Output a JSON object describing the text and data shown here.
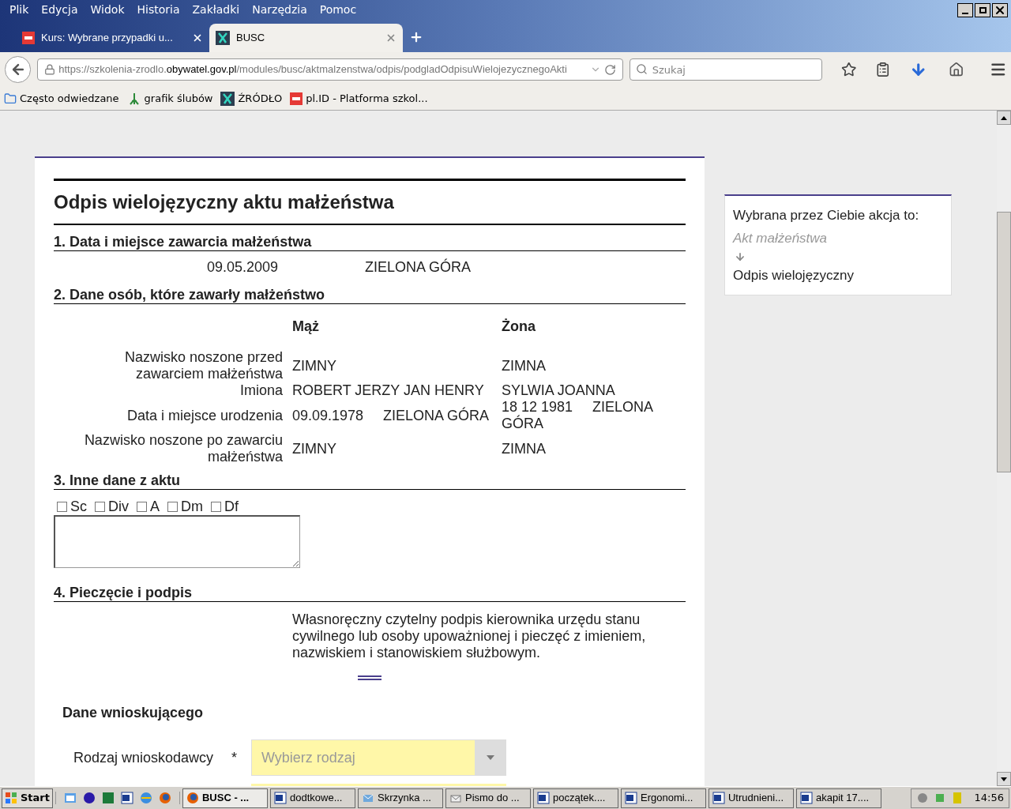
{
  "menu": [
    "Plik",
    "Edycja",
    "Widok",
    "Historia",
    "Zakładki",
    "Narzędzia",
    "Pomoc"
  ],
  "tabs": [
    {
      "label": "Kurs: Wybrane przypadki u...",
      "kind": "plid",
      "selected": false
    },
    {
      "label": "BUSC",
      "kind": "busc",
      "selected": true
    }
  ],
  "url": {
    "prefix": "https://szkolenia-zrodlo.",
    "domain": "obywatel.gov.pl",
    "path": "/modules/busc/aktmalzenstwa/odpis/podgladOdpisuWielojezycznegoAkti"
  },
  "search": {
    "placeholder": "Szukaj"
  },
  "bookmarks": [
    {
      "label": "Często odwiedzane",
      "kind": "folder"
    },
    {
      "label": "grafik ślubów",
      "kind": "tree"
    },
    {
      "label": "ŹRÓDŁO",
      "kind": "busc"
    },
    {
      "label": "pl.ID - Platforma szkol...",
      "kind": "plid"
    }
  ],
  "document": {
    "title": "Odpis wielojęzyczny aktu małżeństwa",
    "section1": {
      "heading": "1. Data i miejsce zawarcia małżeństwa",
      "date": "09.05.2009",
      "place": "ZIELONA GÓRA"
    },
    "section2": {
      "heading": "2. Dane osób, które zawarły małżeństwo",
      "columns": [
        "Mąż",
        "Żona"
      ],
      "rows": [
        {
          "label": "Nazwisko noszone przed zawarciem małżeństwa",
          "husband": "ZIMNY",
          "wife": "ZIMNA"
        },
        {
          "label": "Imiona",
          "husband": "ROBERT JERZY JAN HENRY",
          "wife": "SYLWIA JOANNA"
        },
        {
          "label": "Data i miejsce urodzenia",
          "husband": "09.09.1978     ZIELONA GÓRA",
          "wife": "18 12 1981     ZIELONA GÓRA"
        },
        {
          "label": "Nazwisko noszone po zawarciu małżeństwa",
          "husband": "ZIMNY",
          "wife": "ZIMNA"
        }
      ]
    },
    "section3": {
      "heading": "3. Inne dane z aktu",
      "checkboxes": [
        {
          "label": "Sc",
          "checked": false
        },
        {
          "label": "Div",
          "checked": false
        },
        {
          "label": "A",
          "checked": false
        },
        {
          "label": "Dm",
          "checked": false
        },
        {
          "label": "Df",
          "checked": false
        }
      ]
    },
    "section4": {
      "heading": "4. Pieczęcie i podpis",
      "note": "Własnoręczny czytelny podpis kierownika urzędu stanu cywilnego lub osoby upoważnionej i pieczęć z imieniem, nazwiskiem i stanowiskiem służbowym."
    }
  },
  "applicant": {
    "heading": "Dane wnioskującego",
    "field_label": "Rodzaj wnioskodawcy",
    "required_mark": "*",
    "placeholder": "Wybierz rodzaj"
  },
  "side_panel": {
    "title": "Wybrana przez Ciebie akcja to:",
    "from": "Akt małżeństwa",
    "to": "Odpis wielojęzyczny"
  },
  "taskbar": {
    "start": "Start",
    "tasks": [
      {
        "label": "BUSC - ...",
        "kind": "firefox",
        "selected": true
      },
      {
        "label": "dodtkowe...",
        "kind": "word",
        "selected": false
      },
      {
        "label": "Skrzynka ...",
        "kind": "mail",
        "selected": false
      },
      {
        "label": "Pismo do ...",
        "kind": "envelope",
        "selected": false
      },
      {
        "label": "początek....",
        "kind": "word",
        "selected": false
      },
      {
        "label": "Ergonomi...",
        "kind": "word",
        "selected": false
      },
      {
        "label": "Utrudnieni...",
        "kind": "word",
        "selected": false
      },
      {
        "label": "akapit 17....",
        "kind": "word",
        "selected": false
      }
    ],
    "clock": "14:56"
  }
}
